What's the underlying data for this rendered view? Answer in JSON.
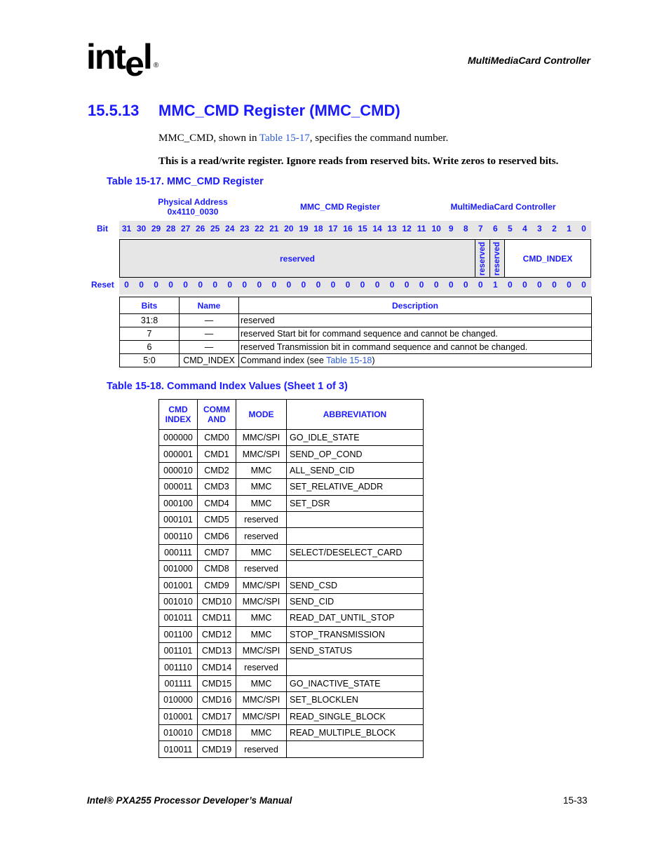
{
  "header": {
    "logo": {
      "text_a": "int",
      "text_e": "e",
      "text_l": "l",
      "registered": "®"
    },
    "section_name": "MultiMediaCard Controller"
  },
  "section": {
    "number": "15.5.13",
    "title": "MMC_CMD Register (MMC_CMD)",
    "intro": {
      "prefix": "MMC_CMD, shown in ",
      "link": "Table 15-17",
      "suffix": ", specifies the command number."
    },
    "note": "This is a read/write register. Ignore reads from reserved bits. Write zeros to reserved bits."
  },
  "register_table": {
    "caption": "Table 15-17. MMC_CMD Register",
    "physical_address_label": "Physical Address",
    "physical_address": "0x4110_0030",
    "register_name": "MMC_CMD Register",
    "unit": "MultiMediaCard Controller",
    "bit_label": "Bit",
    "reset_label": "Reset",
    "bits": [
      "31",
      "30",
      "29",
      "28",
      "27",
      "26",
      "25",
      "24",
      "23",
      "22",
      "21",
      "20",
      "19",
      "18",
      "17",
      "16",
      "15",
      "14",
      "13",
      "12",
      "11",
      "10",
      "9",
      "8",
      "7",
      "6",
      "5",
      "4",
      "3",
      "2",
      "1",
      "0"
    ],
    "reset_values": [
      "0",
      "0",
      "0",
      "0",
      "0",
      "0",
      "0",
      "0",
      "0",
      "0",
      "0",
      "0",
      "0",
      "0",
      "0",
      "0",
      "0",
      "0",
      "0",
      "0",
      "0",
      "0",
      "0",
      "0",
      "0",
      "1",
      "0",
      "0",
      "0",
      "0",
      "0",
      "0"
    ],
    "fields": [
      {
        "name": "reserved",
        "bits": "31:8"
      },
      {
        "name": "reserved",
        "bits": "7"
      },
      {
        "name": "reserved",
        "bits": "6"
      },
      {
        "name": "CMD_INDEX",
        "bits": "5:0"
      }
    ],
    "columns": [
      "Bits",
      "Name",
      "Description"
    ],
    "rows": [
      {
        "bits": "31:8",
        "name": "—",
        "description": "reserved"
      },
      {
        "bits": "7",
        "name": "—",
        "description": "reserved Start bit for command sequence and cannot be changed."
      },
      {
        "bits": "6",
        "name": "—",
        "description": "reserved Transmission bit in command sequence and cannot be changed."
      },
      {
        "bits": "5:0",
        "name": "CMD_INDEX",
        "description_prefix": "Command index (see ",
        "description_link": "Table 15-18",
        "description_suffix": ")"
      }
    ]
  },
  "command_table": {
    "caption": "Table 15-18. Command Index Values (Sheet 1 of 3)",
    "columns": [
      {
        "line1": "CMD",
        "line2": "INDEX"
      },
      {
        "line1": "COMM",
        "line2": "AND"
      },
      {
        "line1": "MODE",
        "line2": ""
      },
      {
        "line1": "ABBREVIATION",
        "line2": ""
      }
    ],
    "rows": [
      [
        "000000",
        "CMD0",
        "MMC/SPI",
        "GO_IDLE_STATE"
      ],
      [
        "000001",
        "CMD1",
        "MMC/SPI",
        "SEND_OP_COND"
      ],
      [
        "000010",
        "CMD2",
        "MMC",
        "ALL_SEND_CID"
      ],
      [
        "000011",
        "CMD3",
        "MMC",
        "SET_RELATIVE_ADDR"
      ],
      [
        "000100",
        "CMD4",
        "MMC",
        "SET_DSR"
      ],
      [
        "000101",
        "CMD5",
        "reserved",
        ""
      ],
      [
        "000110",
        "CMD6",
        "reserved",
        ""
      ],
      [
        "000111",
        "CMD7",
        "MMC",
        "SELECT/DESELECT_CARD"
      ],
      [
        "001000",
        "CMD8",
        "reserved",
        ""
      ],
      [
        "001001",
        "CMD9",
        "MMC/SPI",
        "SEND_CSD"
      ],
      [
        "001010",
        "CMD10",
        "MMC/SPI",
        "SEND_CID"
      ],
      [
        "001011",
        "CMD11",
        "MMC",
        "READ_DAT_UNTIL_STOP"
      ],
      [
        "001100",
        "CMD12",
        "MMC",
        "STOP_TRANSMISSION"
      ],
      [
        "001101",
        "CMD13",
        "MMC/SPI",
        "SEND_STATUS"
      ],
      [
        "001110",
        "CMD14",
        "reserved",
        ""
      ],
      [
        "001111",
        "CMD15",
        "MMC",
        "GO_INACTIVE_STATE"
      ],
      [
        "010000",
        "CMD16",
        "MMC/SPI",
        "SET_BLOCKLEN"
      ],
      [
        "010001",
        "CMD17",
        "MMC/SPI",
        "READ_SINGLE_BLOCK"
      ],
      [
        "010010",
        "CMD18",
        "MMC",
        "READ_MULTIPLE_BLOCK"
      ],
      [
        "010011",
        "CMD19",
        "reserved",
        ""
      ]
    ]
  },
  "footer": {
    "manual_title": "Intel® PXA255 Processor Developer’s Manual",
    "page_number": "15-33"
  }
}
